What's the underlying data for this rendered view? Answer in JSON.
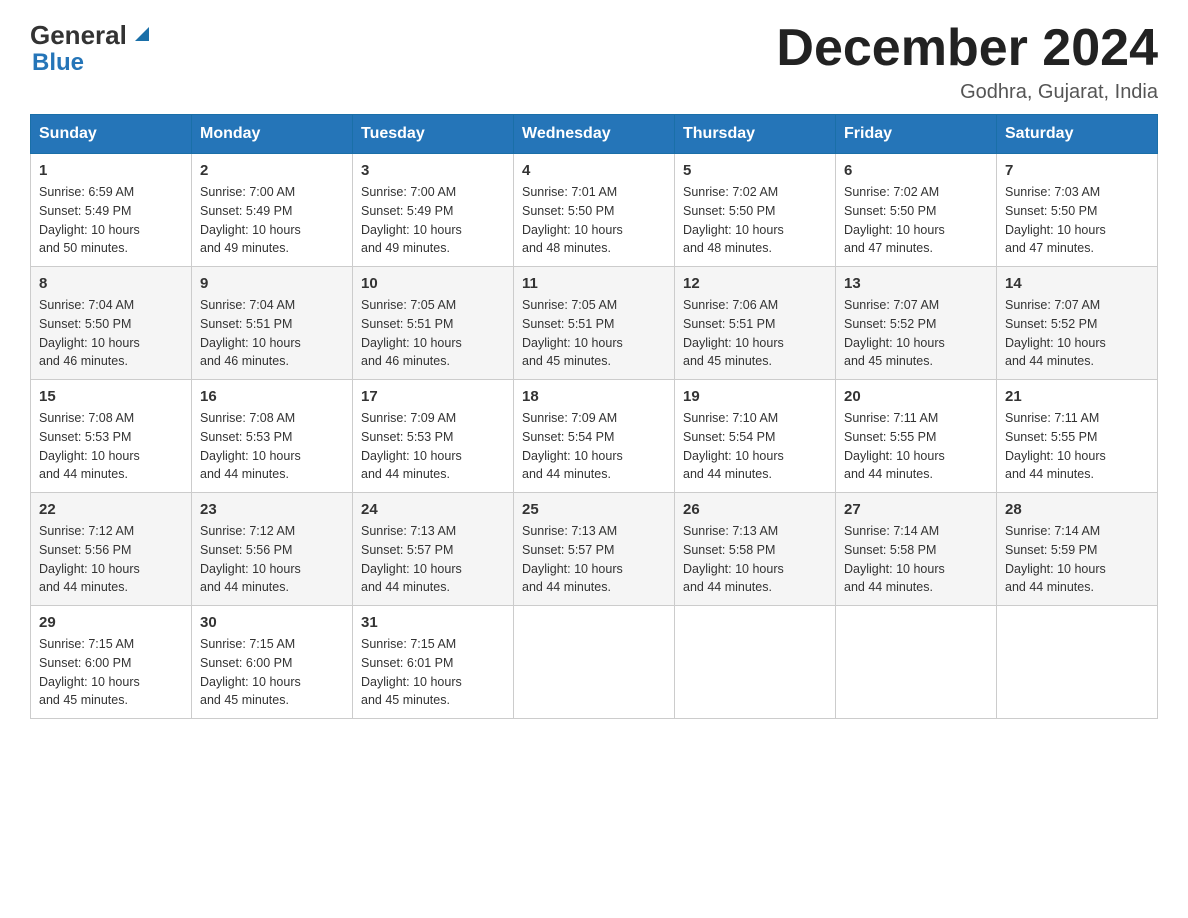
{
  "header": {
    "logo_general": "General",
    "logo_blue": "Blue",
    "title": "December 2024",
    "location": "Godhra, Gujarat, India"
  },
  "days_of_week": [
    "Sunday",
    "Monday",
    "Tuesday",
    "Wednesday",
    "Thursday",
    "Friday",
    "Saturday"
  ],
  "weeks": [
    [
      {
        "day": "1",
        "sunrise": "6:59 AM",
        "sunset": "5:49 PM",
        "daylight": "10 hours and 50 minutes."
      },
      {
        "day": "2",
        "sunrise": "7:00 AM",
        "sunset": "5:49 PM",
        "daylight": "10 hours and 49 minutes."
      },
      {
        "day": "3",
        "sunrise": "7:00 AM",
        "sunset": "5:49 PM",
        "daylight": "10 hours and 49 minutes."
      },
      {
        "day": "4",
        "sunrise": "7:01 AM",
        "sunset": "5:50 PM",
        "daylight": "10 hours and 48 minutes."
      },
      {
        "day": "5",
        "sunrise": "7:02 AM",
        "sunset": "5:50 PM",
        "daylight": "10 hours and 48 minutes."
      },
      {
        "day": "6",
        "sunrise": "7:02 AM",
        "sunset": "5:50 PM",
        "daylight": "10 hours and 47 minutes."
      },
      {
        "day": "7",
        "sunrise": "7:03 AM",
        "sunset": "5:50 PM",
        "daylight": "10 hours and 47 minutes."
      }
    ],
    [
      {
        "day": "8",
        "sunrise": "7:04 AM",
        "sunset": "5:50 PM",
        "daylight": "10 hours and 46 minutes."
      },
      {
        "day": "9",
        "sunrise": "7:04 AM",
        "sunset": "5:51 PM",
        "daylight": "10 hours and 46 minutes."
      },
      {
        "day": "10",
        "sunrise": "7:05 AM",
        "sunset": "5:51 PM",
        "daylight": "10 hours and 46 minutes."
      },
      {
        "day": "11",
        "sunrise": "7:05 AM",
        "sunset": "5:51 PM",
        "daylight": "10 hours and 45 minutes."
      },
      {
        "day": "12",
        "sunrise": "7:06 AM",
        "sunset": "5:51 PM",
        "daylight": "10 hours and 45 minutes."
      },
      {
        "day": "13",
        "sunrise": "7:07 AM",
        "sunset": "5:52 PM",
        "daylight": "10 hours and 45 minutes."
      },
      {
        "day": "14",
        "sunrise": "7:07 AM",
        "sunset": "5:52 PM",
        "daylight": "10 hours and 44 minutes."
      }
    ],
    [
      {
        "day": "15",
        "sunrise": "7:08 AM",
        "sunset": "5:53 PM",
        "daylight": "10 hours and 44 minutes."
      },
      {
        "day": "16",
        "sunrise": "7:08 AM",
        "sunset": "5:53 PM",
        "daylight": "10 hours and 44 minutes."
      },
      {
        "day": "17",
        "sunrise": "7:09 AM",
        "sunset": "5:53 PM",
        "daylight": "10 hours and 44 minutes."
      },
      {
        "day": "18",
        "sunrise": "7:09 AM",
        "sunset": "5:54 PM",
        "daylight": "10 hours and 44 minutes."
      },
      {
        "day": "19",
        "sunrise": "7:10 AM",
        "sunset": "5:54 PM",
        "daylight": "10 hours and 44 minutes."
      },
      {
        "day": "20",
        "sunrise": "7:11 AM",
        "sunset": "5:55 PM",
        "daylight": "10 hours and 44 minutes."
      },
      {
        "day": "21",
        "sunrise": "7:11 AM",
        "sunset": "5:55 PM",
        "daylight": "10 hours and 44 minutes."
      }
    ],
    [
      {
        "day": "22",
        "sunrise": "7:12 AM",
        "sunset": "5:56 PM",
        "daylight": "10 hours and 44 minutes."
      },
      {
        "day": "23",
        "sunrise": "7:12 AM",
        "sunset": "5:56 PM",
        "daylight": "10 hours and 44 minutes."
      },
      {
        "day": "24",
        "sunrise": "7:13 AM",
        "sunset": "5:57 PM",
        "daylight": "10 hours and 44 minutes."
      },
      {
        "day": "25",
        "sunrise": "7:13 AM",
        "sunset": "5:57 PM",
        "daylight": "10 hours and 44 minutes."
      },
      {
        "day": "26",
        "sunrise": "7:13 AM",
        "sunset": "5:58 PM",
        "daylight": "10 hours and 44 minutes."
      },
      {
        "day": "27",
        "sunrise": "7:14 AM",
        "sunset": "5:58 PM",
        "daylight": "10 hours and 44 minutes."
      },
      {
        "day": "28",
        "sunrise": "7:14 AM",
        "sunset": "5:59 PM",
        "daylight": "10 hours and 44 minutes."
      }
    ],
    [
      {
        "day": "29",
        "sunrise": "7:15 AM",
        "sunset": "6:00 PM",
        "daylight": "10 hours and 45 minutes."
      },
      {
        "day": "30",
        "sunrise": "7:15 AM",
        "sunset": "6:00 PM",
        "daylight": "10 hours and 45 minutes."
      },
      {
        "day": "31",
        "sunrise": "7:15 AM",
        "sunset": "6:01 PM",
        "daylight": "10 hours and 45 minutes."
      },
      null,
      null,
      null,
      null
    ]
  ]
}
